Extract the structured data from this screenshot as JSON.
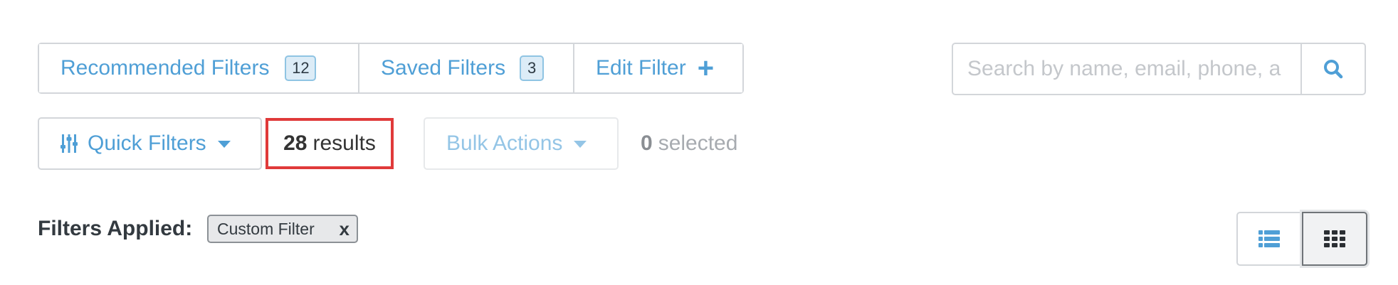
{
  "filter_tabs": {
    "recommended": {
      "label": "Recommended Filters",
      "count": "12"
    },
    "saved": {
      "label": "Saved Filters",
      "count": "3"
    },
    "edit": {
      "label": "Edit Filter",
      "icon": "plus-icon"
    }
  },
  "search": {
    "placeholder": "Search by name, email, phone, a",
    "value": "",
    "button_icon": "search-icon"
  },
  "toolbar": {
    "quick_filters_label": "Quick Filters",
    "quick_filters_icon": "sliders-icon",
    "results_count": "28",
    "results_label": "results",
    "bulk_actions_label": "Bulk Actions",
    "selected_count": "0",
    "selected_label": "selected"
  },
  "filters_applied": {
    "label": "Filters Applied:",
    "chips": [
      {
        "label": "Custom Filter",
        "remove": "x"
      }
    ]
  },
  "view_toggle": {
    "options": [
      "list-view-icon",
      "grid-view-icon"
    ],
    "active": "grid-view-icon"
  },
  "colors": {
    "accent": "#4f9fd6",
    "accent_disabled": "#94c5e6",
    "highlight_border": "#e03a3a",
    "border": "#d3d6da"
  }
}
